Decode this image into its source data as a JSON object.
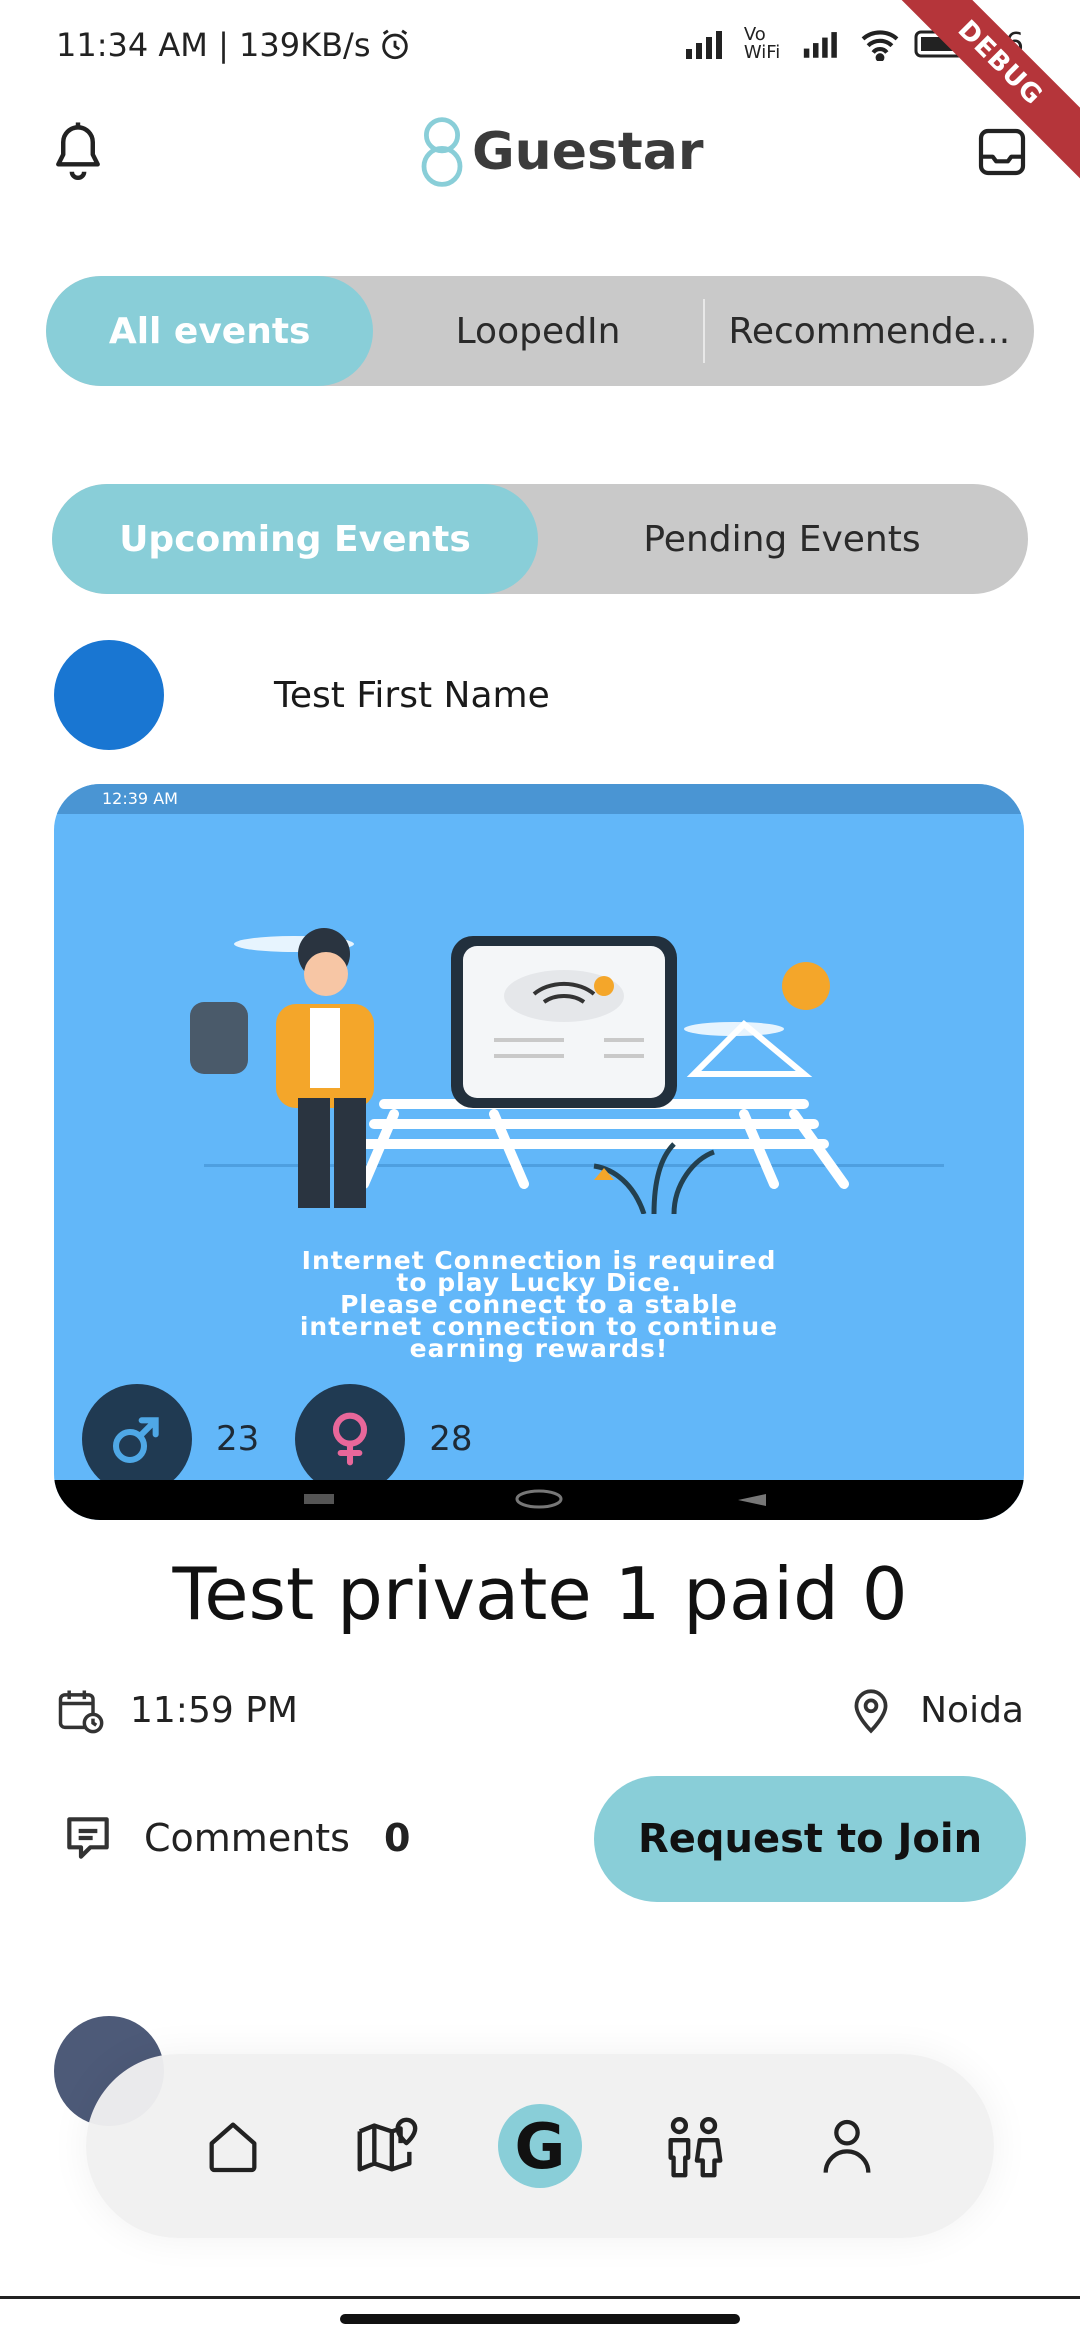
{
  "status": {
    "time_speed": "11:34 AM | 139KB/s",
    "wifi_label": "Vo WiFi",
    "battery": "86",
    "debug": "DEBUG"
  },
  "header": {
    "logo_text": "Guestar"
  },
  "category_tabs": [
    {
      "label": "All events",
      "active": true
    },
    {
      "label": "LoopedIn",
      "active": false
    },
    {
      "label": "Recommende...",
      "active": false
    }
  ],
  "event_tabs": [
    {
      "label": "Upcoming Events",
      "active": true
    },
    {
      "label": "Pending Events",
      "active": false
    }
  ],
  "event": {
    "host_name": "Test First Name",
    "image": {
      "inner_status": "12:39 AM",
      "message": [
        "Internet Connection is required",
        "to play Lucky Dice.",
        "Please connect to a stable",
        "internet connection to continue",
        "earning rewards!"
      ]
    },
    "male_count": "23",
    "female_count": "28",
    "title": "Test private 1 paid 0",
    "time": "11:59 PM",
    "location": "Noida",
    "comments_label": "Comments",
    "comments_count": "0",
    "join_label": "Request to Join"
  },
  "bottom_nav": {
    "center_label": "G",
    "items": [
      "home-icon",
      "map-icon",
      "guestar-icon",
      "people-icon",
      "profile-icon"
    ]
  },
  "colors": {
    "accent": "#89ced8",
    "segment_bg": "#c9c9c9",
    "host_avatar": "#1976d2",
    "image_bg": "#62b7f9",
    "counter_badge": "#203a52"
  }
}
